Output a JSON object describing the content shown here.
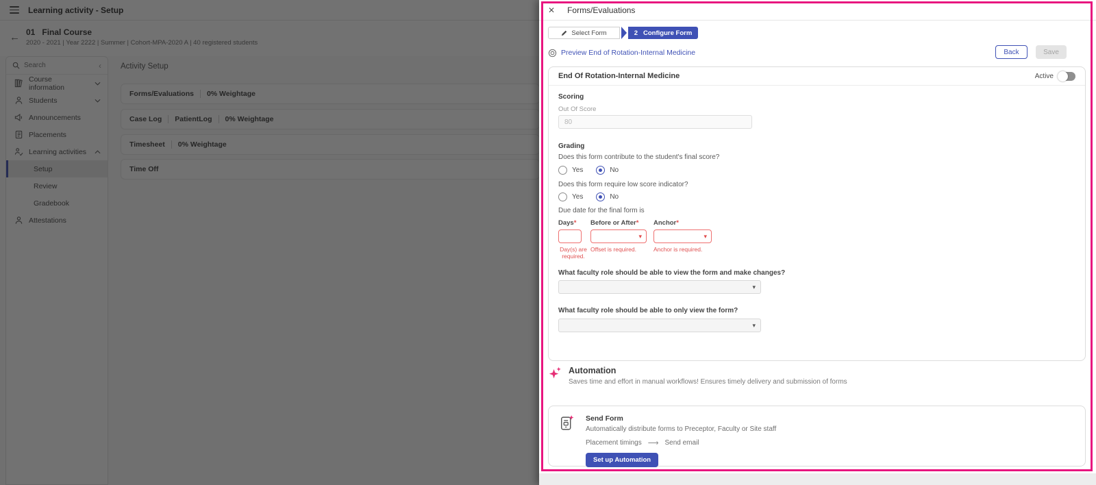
{
  "app": {
    "topbar": {
      "title": "Learning activity - Setup"
    },
    "course_header": {
      "number": "01",
      "title": "Final Course",
      "subtitle": "2020 - 2021 | Year 2222 | Summer | Cohort-MPA-2020 A | 40 registered students"
    },
    "sidebar": {
      "search_placeholder": "Search",
      "items": [
        {
          "label": "Course information"
        },
        {
          "label": "Students"
        },
        {
          "label": "Announcements"
        },
        {
          "label": "Placements"
        },
        {
          "label": "Learning activities"
        },
        {
          "label": "Attestations"
        }
      ],
      "sub_items": [
        {
          "label": "Setup"
        },
        {
          "label": "Review"
        },
        {
          "label": "Gradebook"
        }
      ]
    },
    "main": {
      "heading": "Activity Setup",
      "cards": [
        {
          "a": "Forms/Evaluations",
          "b": "0% Weightage"
        },
        {
          "a": "Case Log",
          "b": "PatientLog",
          "c": "0% Weightage"
        },
        {
          "a": "Timesheet",
          "b": "0% Weightage"
        },
        {
          "a": "Time Off"
        }
      ]
    }
  },
  "drawer": {
    "title": "Forms/Evaluations",
    "stepper": {
      "step1": "Select Form",
      "step2_num": "2",
      "step2": "Configure Form"
    },
    "preview_link": "Preview End of Rotation-Internal Medicine",
    "back_label": "Back",
    "save_label": "Save",
    "form": {
      "title": "End Of Rotation-Internal Medicine",
      "active_label": "Active",
      "scoring_label": "Scoring",
      "out_of_score_label": "Out Of Score",
      "out_of_score_value": "80",
      "grading_label": "Grading",
      "q_final_score": "Does this form contribute to the student's final score?",
      "q_low_score": "Does this form require low score indicator?",
      "yes": "Yes",
      "no": "No",
      "due_date_label": "Due date for the final form is",
      "required_mark": "*",
      "days_label": "Days",
      "days_error": "Day(s) are required.",
      "offset_label": "Before or After",
      "offset_error": "Offset is required.",
      "anchor_label": "Anchor",
      "anchor_error": "Anchor is required.",
      "q_role_edit": "What faculty role should be able to view the form and make changes?",
      "q_role_view": "What faculty role should be able to only view the form?"
    },
    "automation": {
      "title": "Automation",
      "subtitle": "Saves time and effort in manual workflows! Ensures timely delivery and submission of forms",
      "card": {
        "title": "Send Form",
        "description": "Automatically distribute forms to Preceptor, Faculty or Site staff",
        "flow_from": "Placement timings",
        "flow_to": "Send email",
        "button": "Set up Automation"
      }
    }
  },
  "icons": {
    "close": "✕",
    "back_arrow": "←",
    "collapse": "‹",
    "caret": "▾",
    "flow_arrow": "⟶"
  },
  "colors": {
    "accent": "#3f51b5",
    "annotation": "#e8157f",
    "error": "#e05151",
    "pink_sparkle": "#e62e75"
  }
}
